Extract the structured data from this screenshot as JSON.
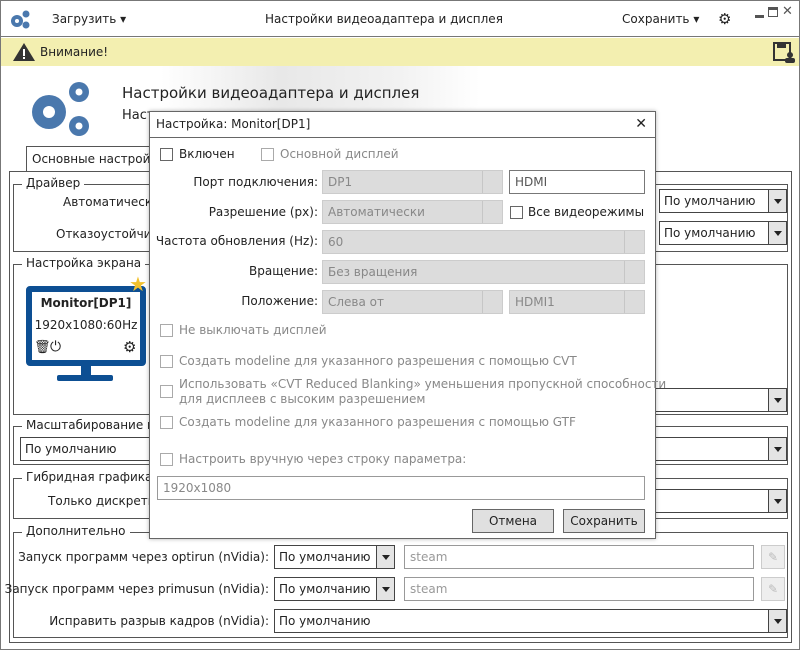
{
  "titlebar": {
    "title": "Настройки видеоадаптера и дисплея",
    "load_menu": "Загрузить",
    "save_menu": "Сохранить"
  },
  "warning": {
    "text": "Внимание!"
  },
  "header": {
    "title": "Настройки видеоадаптера и дисплея",
    "subtitle": "Наст"
  },
  "tabs": [
    {
      "label": "Основные настройки"
    }
  ],
  "driver": {
    "legend": "Драйвер",
    "row1_label": "Автоматически",
    "row1_value": "По умолчанию",
    "row2_label": "Отказоустойчив",
    "row2_value": "По умолчанию"
  },
  "screen": {
    "legend": "Настройка экрана",
    "monitor_name": "Monitor[DP1]",
    "monitor_mode": "1920x1080:60Hz"
  },
  "scaling": {
    "legend": "Масштабирование вы",
    "value": "По умолчанию"
  },
  "hybrid": {
    "legend": "Гибридная графика",
    "label": "Только дискретн"
  },
  "extra": {
    "legend": "Дополнительно",
    "rows": [
      {
        "label": "Запуск программ через optirun (nVidia):",
        "value": "По умолчанию",
        "text": "steam"
      },
      {
        "label": "Запуск программ через primusun (nVidia):",
        "value": "По умолчанию",
        "text": "steam"
      },
      {
        "label": "Исправить разрыв кадров (nVidia):",
        "value": "По умолчанию"
      }
    ]
  },
  "dialog": {
    "title": "Настройка: Monitor[DP1]",
    "enabled": "Включен",
    "primary": "Основной дисплей",
    "port_label": "Порт подключения:",
    "port_value": "DP1",
    "port_name": "HDMI",
    "res_label": "Разрешение (px):",
    "res_value": "Автоматически",
    "all_modes": "Все видеорежимы",
    "freq_label": "Частота обновления (Hz):",
    "freq_value": "60",
    "rot_label": "Вращение:",
    "rot_value": "Без вращения",
    "pos_label": "Положение:",
    "pos_value": "Слева от",
    "pos_target": "HDMI1",
    "no_off": "Не выключать дисплей",
    "cvt": "Создать modeline для указанного разрешения с помощью CVT",
    "cvt_rb_1": "Использовать «CVT Reduced Blanking» уменьшения пропускной способности",
    "cvt_rb_2": "для дисплеев с высоким разрешением",
    "gtf": "Создать modeline для указанного разрешения с помощью GTF",
    "manual": "Настроить вручную через строку параметра:",
    "manual_value": "1920x1080",
    "cancel": "Отмена",
    "save": "Сохранить"
  },
  "colors": {
    "accent": "#4a78ad",
    "monitor": "#0d4f93",
    "warning_bg": "#f3efb0",
    "star": "#f2c12e"
  }
}
